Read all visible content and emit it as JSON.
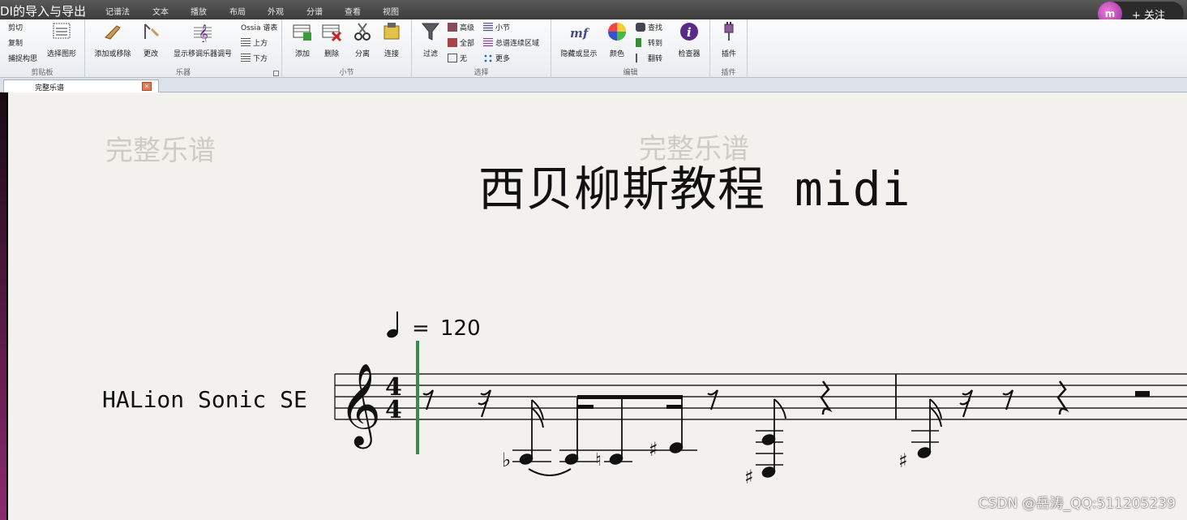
{
  "video_title": "DI的导入与导出",
  "menu_tabs": [
    "记谱法",
    "文本",
    "播放",
    "布局",
    "外观",
    "分谱",
    "查看",
    "视图"
  ],
  "follow": {
    "avatar_text": "m",
    "label": "+ 关注"
  },
  "ribbon": {
    "clipboard": {
      "cut": "剪切",
      "copy": "复制",
      "capture": "捕捉构思",
      "select_graphic": "选择图形",
      "group": "剪贴板"
    },
    "instruments": {
      "add_remove": "添加或移除",
      "change": "更改",
      "show_transpose": "显示移调乐器调号",
      "ossia": "Ossia 谱表",
      "above": "上方",
      "below": "下方",
      "group": "乐器"
    },
    "bars": {
      "add": "添加",
      "delete": "删除",
      "split": "分离",
      "join": "连接",
      "group": "小节"
    },
    "select": {
      "filter": "过滤",
      "advanced": "高级",
      "all": "全部",
      "none": "无",
      "bar": "小节",
      "system_passage": "总谱连续区域",
      "more": "更多",
      "group": "选择"
    },
    "edit": {
      "hide_show": "隐藏或显示",
      "color": "颜色",
      "find": "查找",
      "goto": "转到",
      "flip": "翻转",
      "inspector": "检查器",
      "group": "编辑"
    },
    "plugins": {
      "plugins": "插件",
      "group": "插件"
    }
  },
  "doc_tab": {
    "label": "完整乐谱"
  },
  "score": {
    "watermark_left": "完整乐谱",
    "watermark_center": "完整乐谱",
    "title": "西贝柳斯教程 midi",
    "tempo_equals": "=",
    "tempo_value": "120",
    "instrument": "HALion Sonic SE",
    "time_signature": [
      "4",
      "4"
    ]
  },
  "credit": "CSDN @岳涛_QQ:511205239",
  "colors": {
    "cursor": "#3a8a4a",
    "left_bar": "#6b1f55"
  }
}
